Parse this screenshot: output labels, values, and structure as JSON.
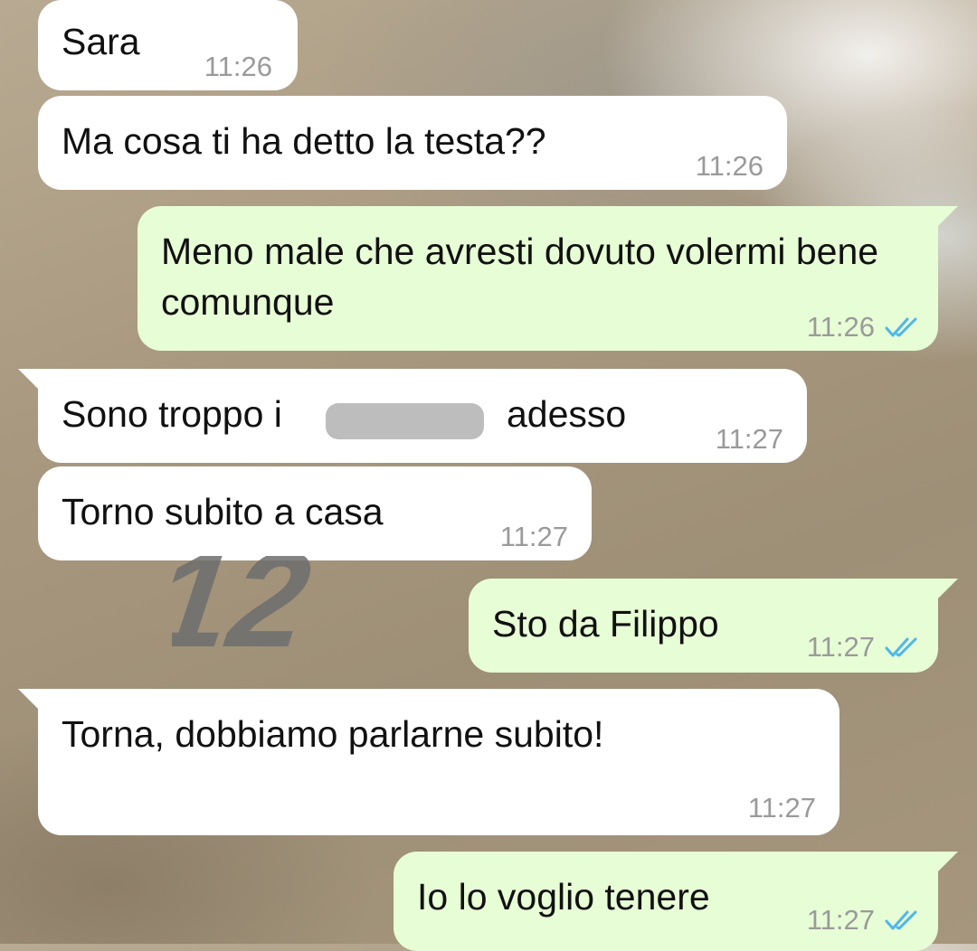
{
  "messages": [
    {
      "text": "Sara",
      "time": "11:26",
      "direction": "in"
    },
    {
      "text": "Ma cosa ti ha detto la testa??",
      "time": "11:26",
      "direction": "in"
    },
    {
      "text": "Meno male che avresti dovuto volermi bene comunque",
      "time": "11:26",
      "direction": "out",
      "status": "read"
    },
    {
      "text_before": "Sono troppo i",
      "text_after": "adesso",
      "time": "11:27",
      "direction": "in",
      "redacted": true
    },
    {
      "text": "Torno subito a casa",
      "time": "11:27",
      "direction": "in"
    },
    {
      "text": "Sto da Filippo",
      "time": "11:27",
      "direction": "out",
      "status": "read"
    },
    {
      "text": "Torna, dobbiamo parlarne subito!",
      "time": "11:27",
      "direction": "in"
    },
    {
      "text": "Io lo voglio tenere",
      "time": "11:27",
      "direction": "out",
      "status": "read"
    }
  ],
  "overlay_mark": "12",
  "colors": {
    "incoming": "#ffffff",
    "outgoing": "#e7fdd6",
    "read_ticks": "#4fb6ec",
    "timestamp": "#9a9a9a"
  }
}
